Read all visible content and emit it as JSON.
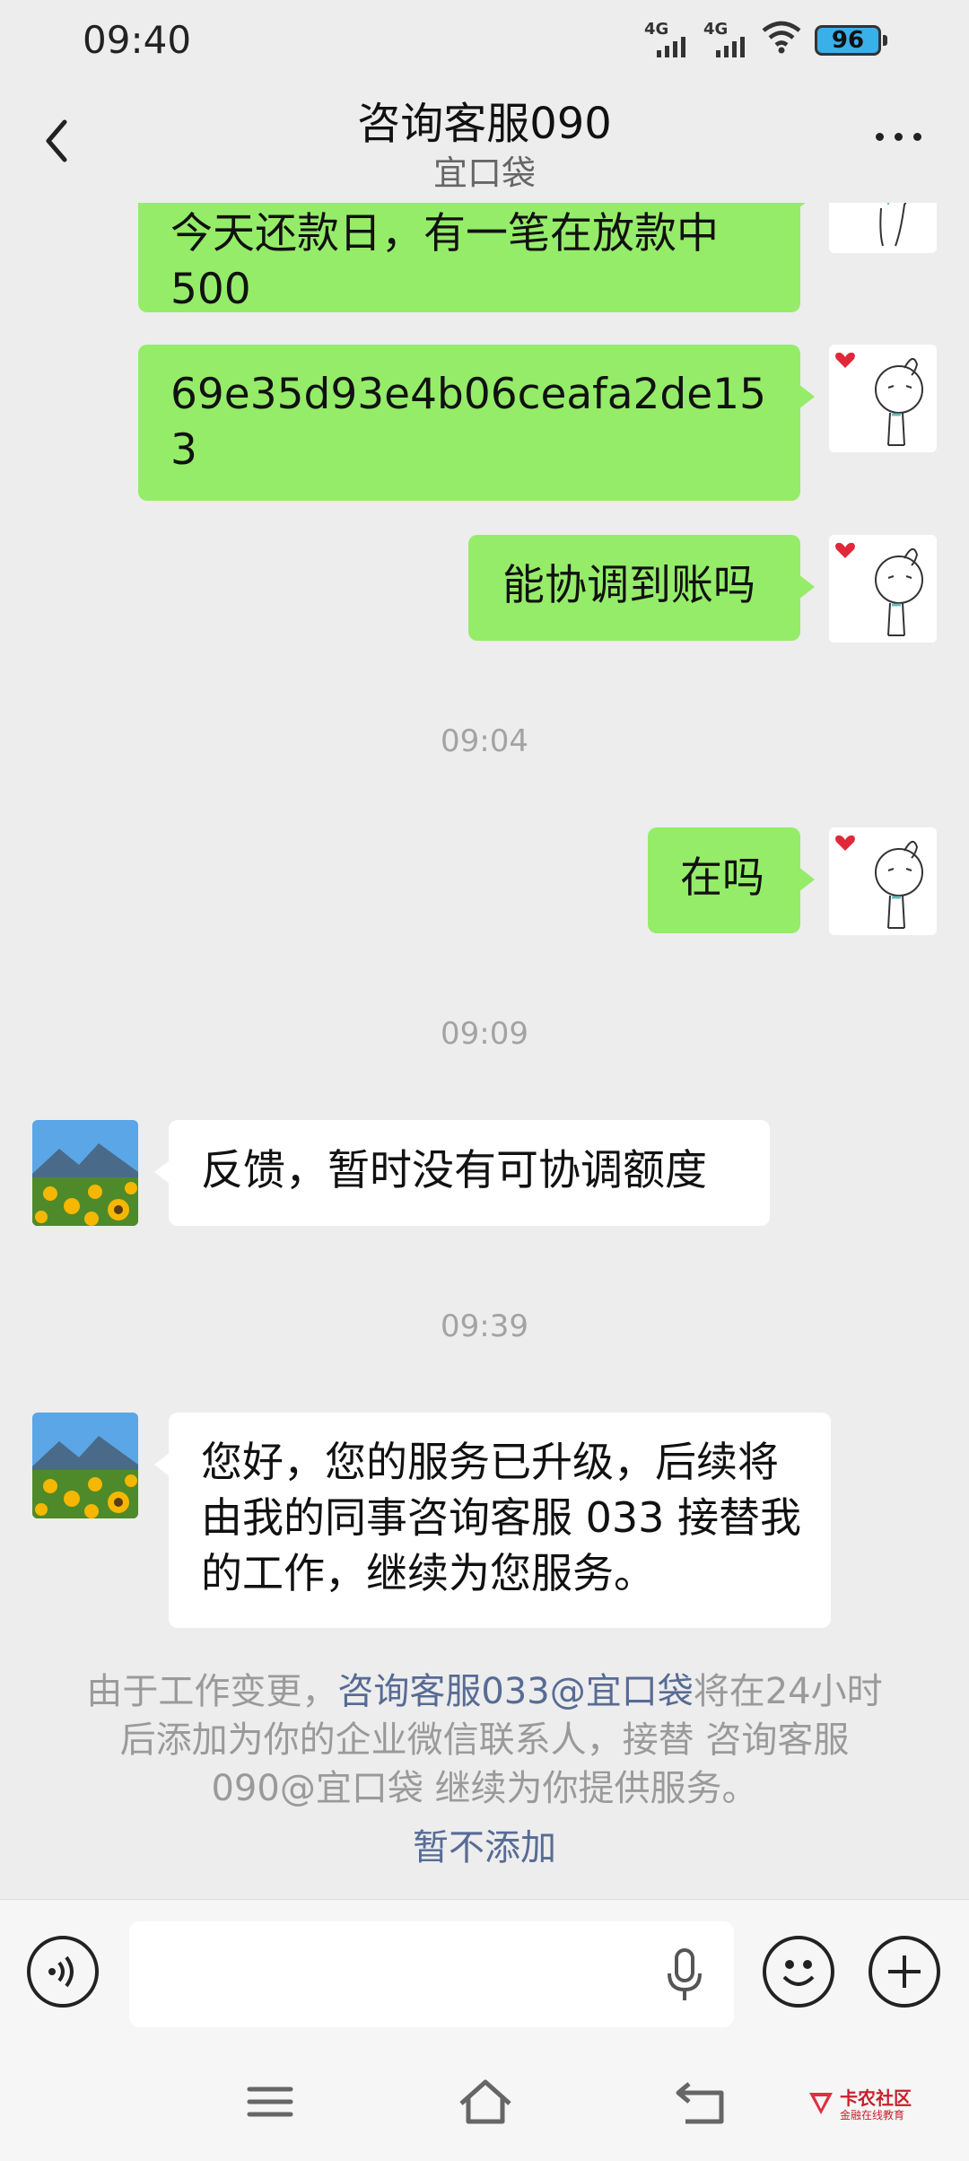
{
  "status_bar": {
    "time": "09:40",
    "signal1": "4G",
    "signal2": "4G",
    "battery": "96"
  },
  "header": {
    "title": "咨询客服090",
    "subtitle": "宜口袋"
  },
  "messages": [
    {
      "side": "me",
      "text": "今天还款日，有一笔在放款中500"
    },
    {
      "side": "me",
      "text": "69e35d93e4b06ceafa2de153"
    },
    {
      "side": "me",
      "text": "能协调到账吗"
    },
    {
      "type": "time",
      "text": "09:04"
    },
    {
      "side": "me",
      "text": "在吗"
    },
    {
      "type": "time",
      "text": "09:09"
    },
    {
      "side": "cs",
      "text": "反馈，暂时没有可协调额度"
    },
    {
      "type": "time",
      "text": "09:39"
    },
    {
      "side": "cs",
      "text": "您好，您的服务已升级，后续将由我的同事咨询客服 033 接替我的工作，继续为您服务。"
    }
  ],
  "system_notice": {
    "prefix": "由于工作变更，",
    "link": "咨询客服033@宜口袋",
    "suffix": "将在24小时后添加为你的企业微信联系人，接替 咨询客服090@宜口袋 继续为你提供服务。",
    "action": "暂不添加"
  },
  "input": {
    "placeholder": "",
    "value": ""
  },
  "watermark": {
    "name": "卡农社区",
    "tagline": "金融在线教育"
  },
  "colors": {
    "my_bubble": "#95ec69",
    "their_bubble": "#ffffff",
    "background": "#ededed",
    "link": "#576b95"
  }
}
